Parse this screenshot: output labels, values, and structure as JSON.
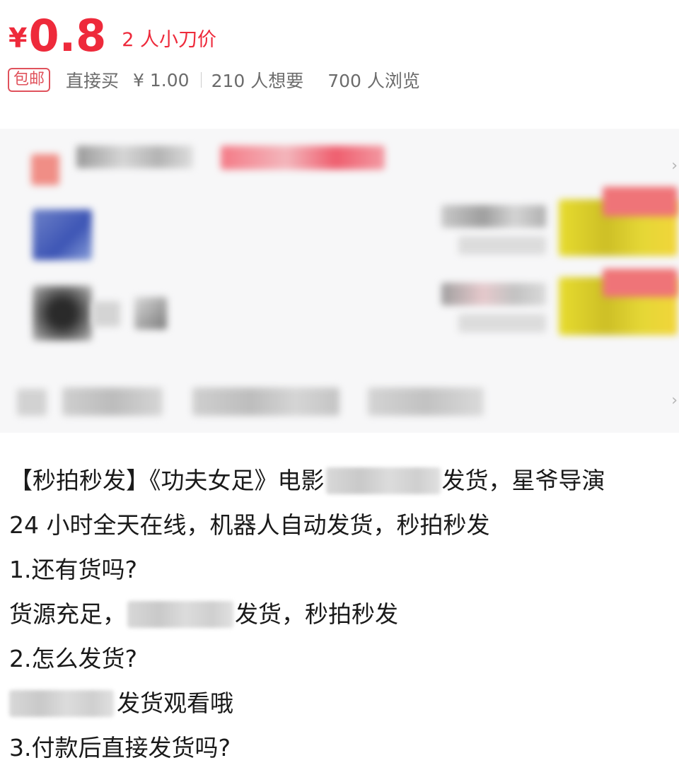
{
  "price": {
    "symbol": "¥",
    "value": "0.8",
    "note": "2 人小刀价"
  },
  "meta": {
    "badge": "包邮",
    "buy_direct": "直接买",
    "buy_price": "¥ 1.00",
    "wants": "210 人想要",
    "views": "700 人浏览"
  },
  "description": {
    "line1_a": "【秒拍秒发】《功夫女足》电影",
    "line1_b": "发货，星爷导演",
    "line2": "24 小时全天在线，机器人自动发货，秒拍秒发",
    "line3": "1.还有货吗?",
    "line4_a": "货源充足，",
    "line4_b": "发货，秒拍秒发",
    "line5": "2.怎么发货?",
    "line6_b": "发货观看哦",
    "line7": "3.付款后直接发货吗?"
  },
  "colors": {
    "price_red": "#ee2a3b",
    "badge_red": "#e0525c",
    "card_bg": "#f7f7f8"
  }
}
